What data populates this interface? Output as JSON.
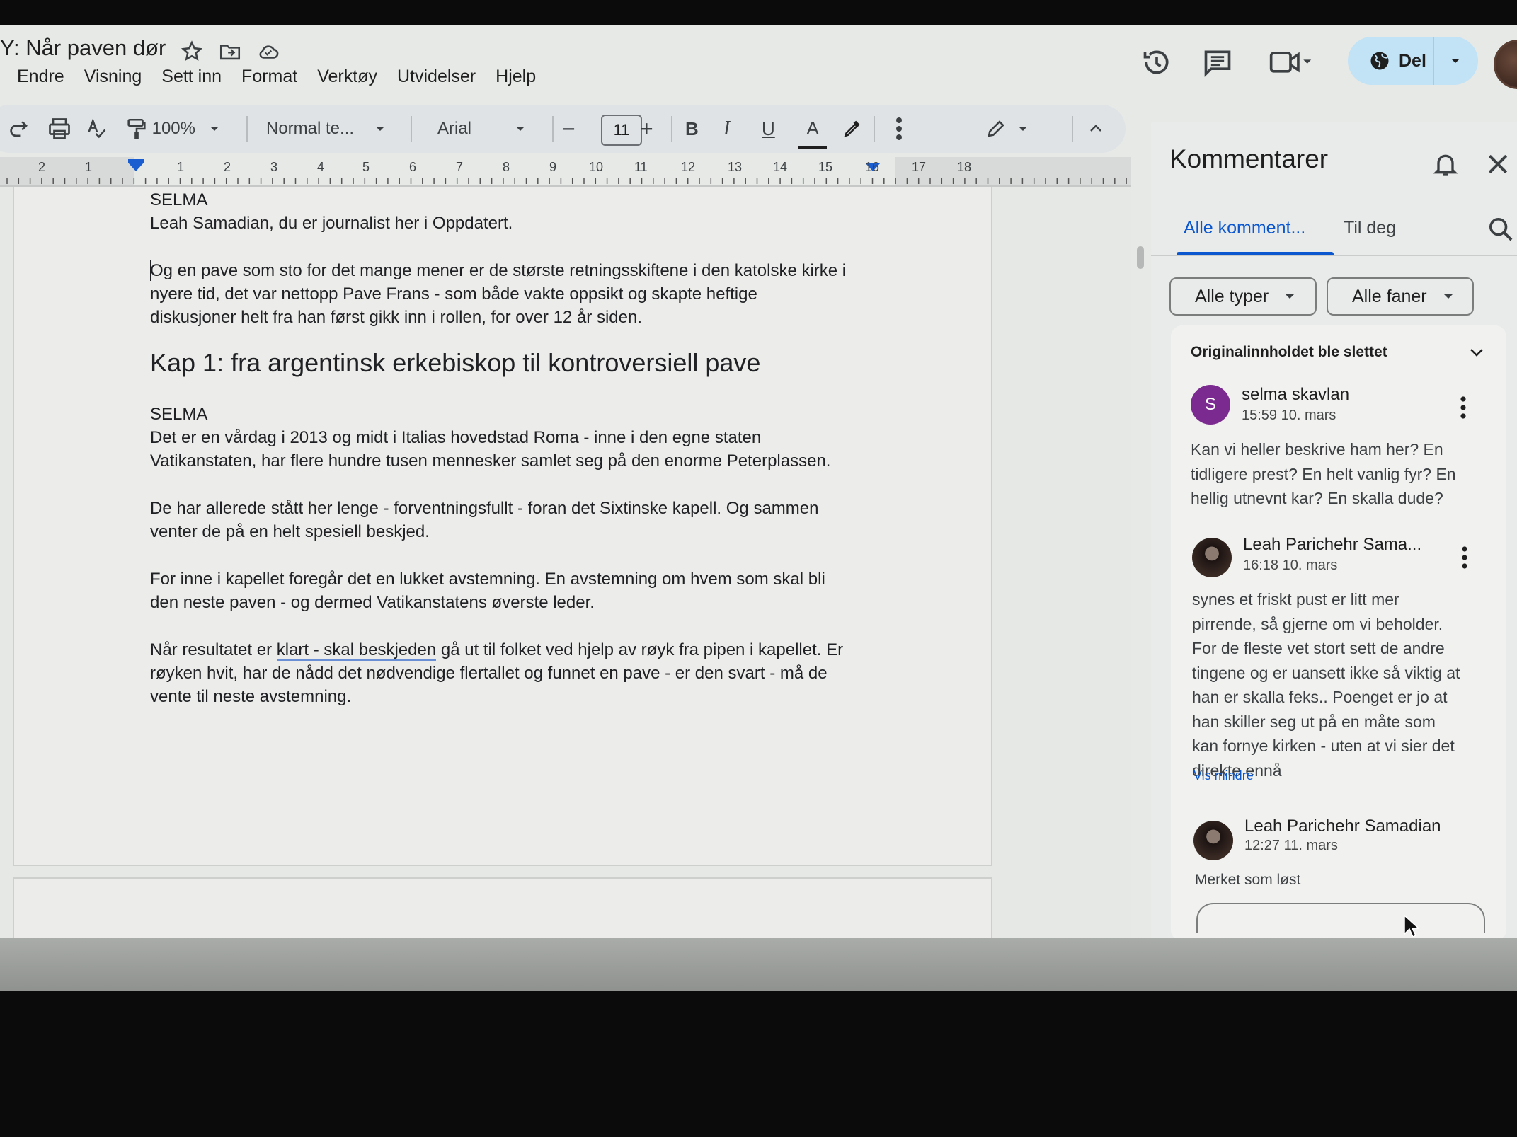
{
  "doc": {
    "title": "Y: Når paven dør"
  },
  "menu": [
    "Endre",
    "Visning",
    "Sett inn",
    "Format",
    "Verktøy",
    "Utvidelser",
    "Hjelp"
  ],
  "share": {
    "label": "Del"
  },
  "toolbar": {
    "zoom": "100%",
    "style": "Normal te...",
    "font": "Arial",
    "font_size": "11",
    "bold": "B",
    "italic": "I",
    "underline": "U",
    "text_color": "A"
  },
  "ruler": [
    "2",
    "1",
    "1",
    "2",
    "3",
    "4",
    "5",
    "6",
    "7",
    "8",
    "9",
    "10",
    "11",
    "12",
    "13",
    "14",
    "15",
    "16",
    "17",
    "18"
  ],
  "body": {
    "speaker1": "SELMA",
    "intro": "Leah Samadian, du er journalist her i Oppdatert.",
    "para1_l1": "Og en pave som sto for det mange mener er de største retningsskiftene i den katolske kirke i",
    "para1_l2": "nyere tid, det var nettopp Pave Frans - som både vakte oppsikt og skapte heftige",
    "para1_l3": "diskusjoner helt fra han først gikk inn i rollen, for over 12 år siden.",
    "heading": "Kap 1: fra argentinsk erkebiskop til kontroversiell pave",
    "speaker2": "SELMA",
    "para2_l1": "Det er en vårdag i 2013 og midt i Italias hovedstad Roma - inne i den egne staten",
    "para2_l2": "Vatikanstaten, har flere hundre tusen mennesker samlet seg på den enorme Peterplassen.",
    "para3_l1": "De har allerede stått her lenge - forventningsfullt - foran det Sixtinske kapell. Og sammen",
    "para3_l2": "venter de på en helt spesiell beskjed.",
    "para4_l1": "For inne i kapellet foregår det en lukket avstemning. En avstemning om hvem som skal bli",
    "para4_l2": "den neste paven - og dermed Vatikanstatens øverste leder.",
    "para5_l1a": "Når resultatet er ",
    "para5_l1_link": "klart - skal beskjeden",
    "para5_l1b": " gå ut til folket ved hjelp av røyk fra pipen i kapellet. Er",
    "para5_l2": "røyken hvit, har de nådd det nødvendige flertallet og funnet en pave - er den svart - må de",
    "para5_l3": "vente til neste avstemning."
  },
  "comments": {
    "title": "Kommentarer",
    "tab_all": "Alle komment...",
    "tab_you": "Til deg",
    "filter_types": "Alle typer",
    "filter_tabs": "Alle faner",
    "thread_header": "Originalinnholdet ble slettet",
    "c1": {
      "initial": "S",
      "name": "selma skavlan",
      "time": "15:59 10. mars",
      "l1": "Kan vi heller beskrive ham her? En",
      "l2": "tidligere prest? En helt vanlig fyr? En",
      "l3": "hellig utnevnt kar? En skalla dude?"
    },
    "c2": {
      "name": "Leah Parichehr Sama...",
      "time": "16:18 10. mars",
      "l1": "synes et friskt pust er litt mer",
      "l2": "pirrende, så gjerne om vi beholder.",
      "l3": "For de fleste vet stort sett de andre",
      "l4": "tingene og er uansett ikke så viktig at",
      "l5": "han er skalla feks.. Poenget er jo at",
      "l6": "han skiller seg ut på en måte som",
      "l7": "kan fornye kirken - uten at vi sier det",
      "l8": "direkte ennå"
    },
    "show_less": "Vis mindre",
    "c3": {
      "name": "Leah Parichehr Samadian",
      "time": "12:27 11. mars"
    },
    "resolved": "Merket som løst"
  },
  "colors": {
    "accent": "#0b57d0",
    "share_bg": "#c2e2f6",
    "selma_avatar": "#7b2b8f"
  }
}
